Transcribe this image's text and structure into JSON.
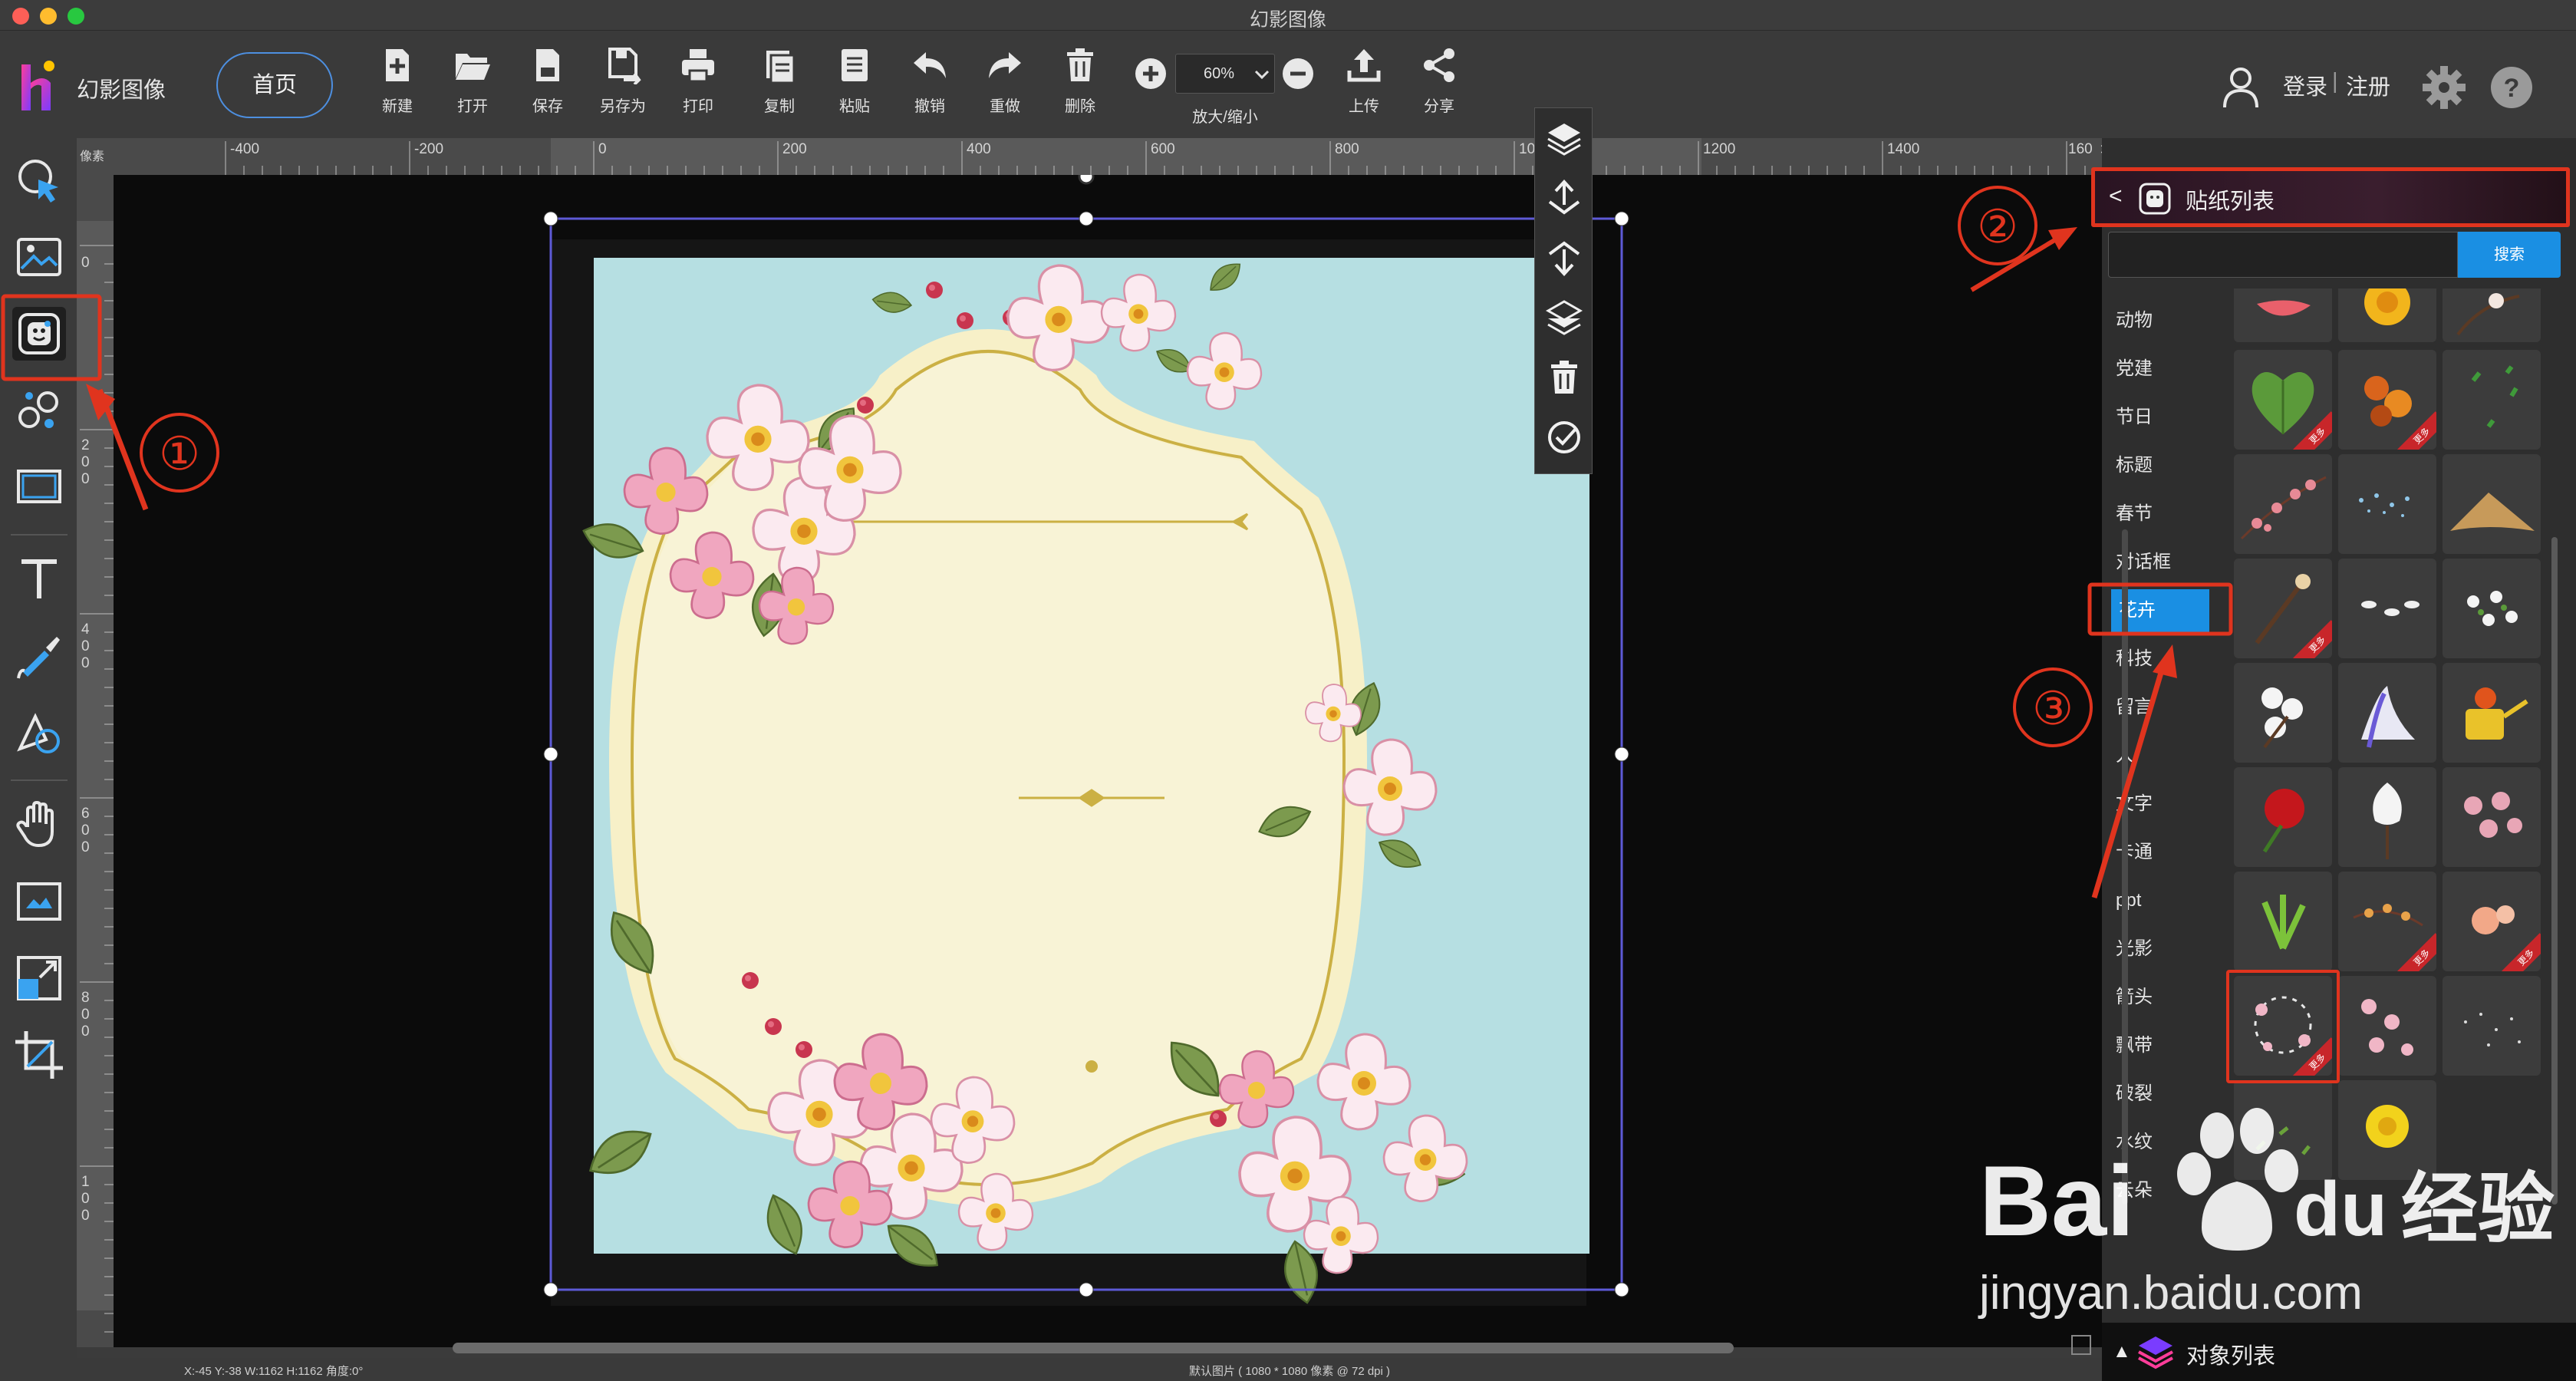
{
  "window": {
    "title": "幻影图像"
  },
  "app": {
    "name": "幻影图像"
  },
  "toolbar": {
    "home_label": "首页",
    "buttons": [
      {
        "id": "new",
        "label": "新建",
        "icon": "new-file-icon"
      },
      {
        "id": "open",
        "label": "打开",
        "icon": "folder-open-icon"
      },
      {
        "id": "save",
        "label": "保存",
        "icon": "save-icon"
      },
      {
        "id": "saveas",
        "label": "另存为",
        "icon": "save-as-icon"
      },
      {
        "id": "print",
        "label": "打印",
        "icon": "print-icon"
      },
      {
        "id": "copy",
        "label": "复制",
        "icon": "copy-icon"
      },
      {
        "id": "paste",
        "label": "粘贴",
        "icon": "paste-icon"
      },
      {
        "id": "undo",
        "label": "撤销",
        "icon": "undo-icon"
      },
      {
        "id": "redo",
        "label": "重做",
        "icon": "redo-icon"
      },
      {
        "id": "delete",
        "label": "删除",
        "icon": "trash-icon"
      },
      {
        "id": "upload",
        "label": "上传",
        "icon": "upload-icon"
      },
      {
        "id": "share",
        "label": "分享",
        "icon": "share-icon"
      }
    ],
    "zoom_value": "60%",
    "zoom_label": "放大/缩小"
  },
  "account": {
    "login": "登录",
    "separator": "|",
    "register": "注册"
  },
  "ruler": {
    "unit": "像素",
    "h_labels": [
      "-400",
      "-200",
      "0",
      "200",
      "400",
      "600",
      "800",
      "10",
      "1200",
      "1400",
      "160"
    ],
    "v_labels": [
      "0",
      "2\n0\n0",
      "4\n0\n0",
      "6\n0\n0",
      "8\n0\n0",
      "1\n0\n0"
    ],
    "more_arrow": ">>"
  },
  "status": {
    "coords": "X:-45  Y:-38  W:1162  H:1162  角度:0°",
    "image_info": "默认图片 ( 1080 * 1080 像素 @ 72 dpi )"
  },
  "sticker_panel": {
    "back": "<",
    "title": "贴纸列表",
    "search_placeholder": "",
    "search_button": "搜索",
    "categories": [
      "动物",
      "党建",
      "节日",
      "标题",
      "春节",
      "对话框",
      "花卉",
      "科技",
      "留言",
      "人",
      "文字",
      "卡通",
      "ppt",
      "光影",
      "箭头",
      "飘带",
      "破裂",
      "水纹",
      "云朵"
    ],
    "active_category": "花卉",
    "more_badge": "更多"
  },
  "object_list": {
    "title": "对象列表",
    "arrow": "▲"
  },
  "annotations": [
    "①",
    "②",
    "③"
  ],
  "watermark": {
    "text": "jingyan.baidu.com",
    "logo_text": "Bai经验"
  },
  "colors": {
    "accent_blue": "#1a8fe3",
    "annotation_red": "#e0341e",
    "canvas_bg": "#0b0b0b"
  }
}
